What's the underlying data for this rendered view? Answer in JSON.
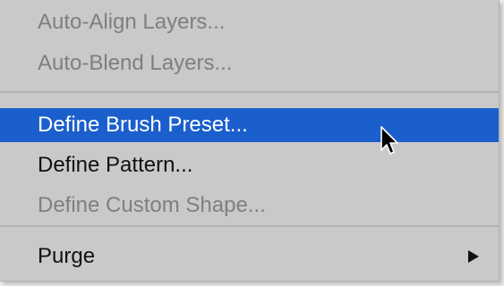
{
  "menu": {
    "items": [
      {
        "label": "Auto-Align Layers...",
        "state": "disabled"
      },
      {
        "label": "Auto-Blend Layers...",
        "state": "disabled"
      },
      {
        "label": "Define Brush Preset...",
        "state": "highlighted"
      },
      {
        "label": "Define Pattern...",
        "state": "enabled"
      },
      {
        "label": "Define Custom Shape...",
        "state": "disabled"
      },
      {
        "label": "Purge",
        "state": "enabled",
        "has_submenu": true
      }
    ]
  },
  "icons": {
    "cursor": "mouse-pointer-arrow-icon",
    "submenu": "submenu-arrow-icon"
  },
  "colors": {
    "menu_background": "#c9c9c9",
    "highlight": "#1a5fcc",
    "disabled_text": "#7f7f7f",
    "enabled_text": "#111111"
  }
}
